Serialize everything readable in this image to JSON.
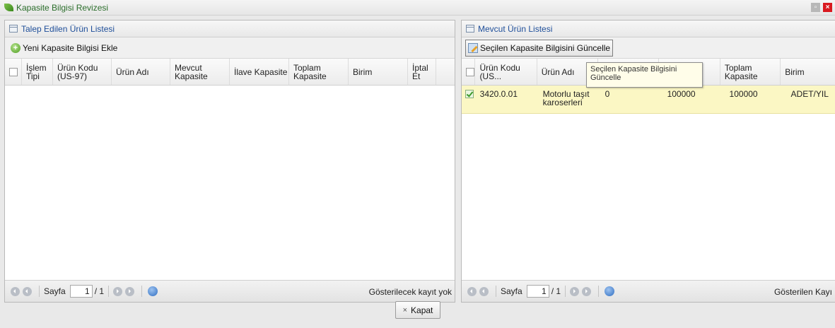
{
  "window": {
    "title": "Kapasite Bilgisi Revizesi"
  },
  "left_panel": {
    "title": "Talep Edilen Ürün Listesi",
    "add_button": "Yeni Kapasite Bilgisi Ekle",
    "columns": [
      "İşlem Tipi",
      "Ürün Kodu (US-97)",
      "Ürün Adı",
      "Mevcut Kapasite",
      "İlave Kapasite",
      "Toplam Kapasite",
      "Birim",
      "İptal Et"
    ],
    "pager": {
      "label": "Sayfa",
      "page": "1",
      "total": "/ 1",
      "status": "Gösterilecek kayıt yok"
    }
  },
  "right_panel": {
    "title": "Mevcut Ürün Listesi",
    "update_button": "Seçilen Kapasite Bilgisini Güncelle",
    "tooltip": "Seçilen Kapasite Bilgisini Güncelle",
    "columns": [
      "Ürün Kodu (US...",
      "Ürün Adı",
      "",
      "",
      "Toplam Kapasite",
      "Birim"
    ],
    "rows": [
      {
        "checked": true,
        "code": "3420.0.01",
        "name": "Motorlu taşıt karoserleri",
        "c3": "0",
        "c4": "100000",
        "total": "100000",
        "unit": "ADET/YIL"
      }
    ],
    "pager": {
      "label": "Sayfa",
      "page": "1",
      "total": "/ 1",
      "status": "Gösterilen Kayı"
    }
  },
  "footer": {
    "close_button": "Kapat",
    "close_icon": "×"
  },
  "colors": {
    "title_green": "#2b6e2b",
    "header_blue": "#1f4f9a",
    "selected_row": "#fbf7c4"
  }
}
